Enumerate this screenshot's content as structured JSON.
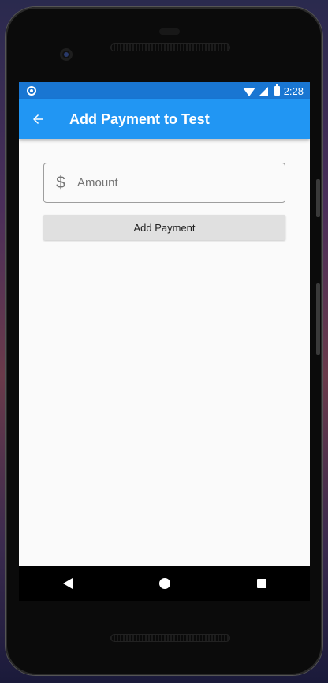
{
  "status_bar": {
    "time": "2:28"
  },
  "app_bar": {
    "title": "Add Payment to Test",
    "back_icon": "arrow-back-icon"
  },
  "form": {
    "amount_prefix_icon": "dollar-icon",
    "amount_prefix_symbol": "$",
    "amount_placeholder": "Amount",
    "amount_value": "",
    "submit_label": "Add Payment"
  },
  "nav_bar": {
    "icons": [
      "nav-back-icon",
      "nav-home-icon",
      "nav-recents-icon"
    ]
  },
  "colors": {
    "status_bar": "#1976d2",
    "app_bar": "#2196f3",
    "button": "#e0e0e0",
    "background": "#fafafa"
  }
}
